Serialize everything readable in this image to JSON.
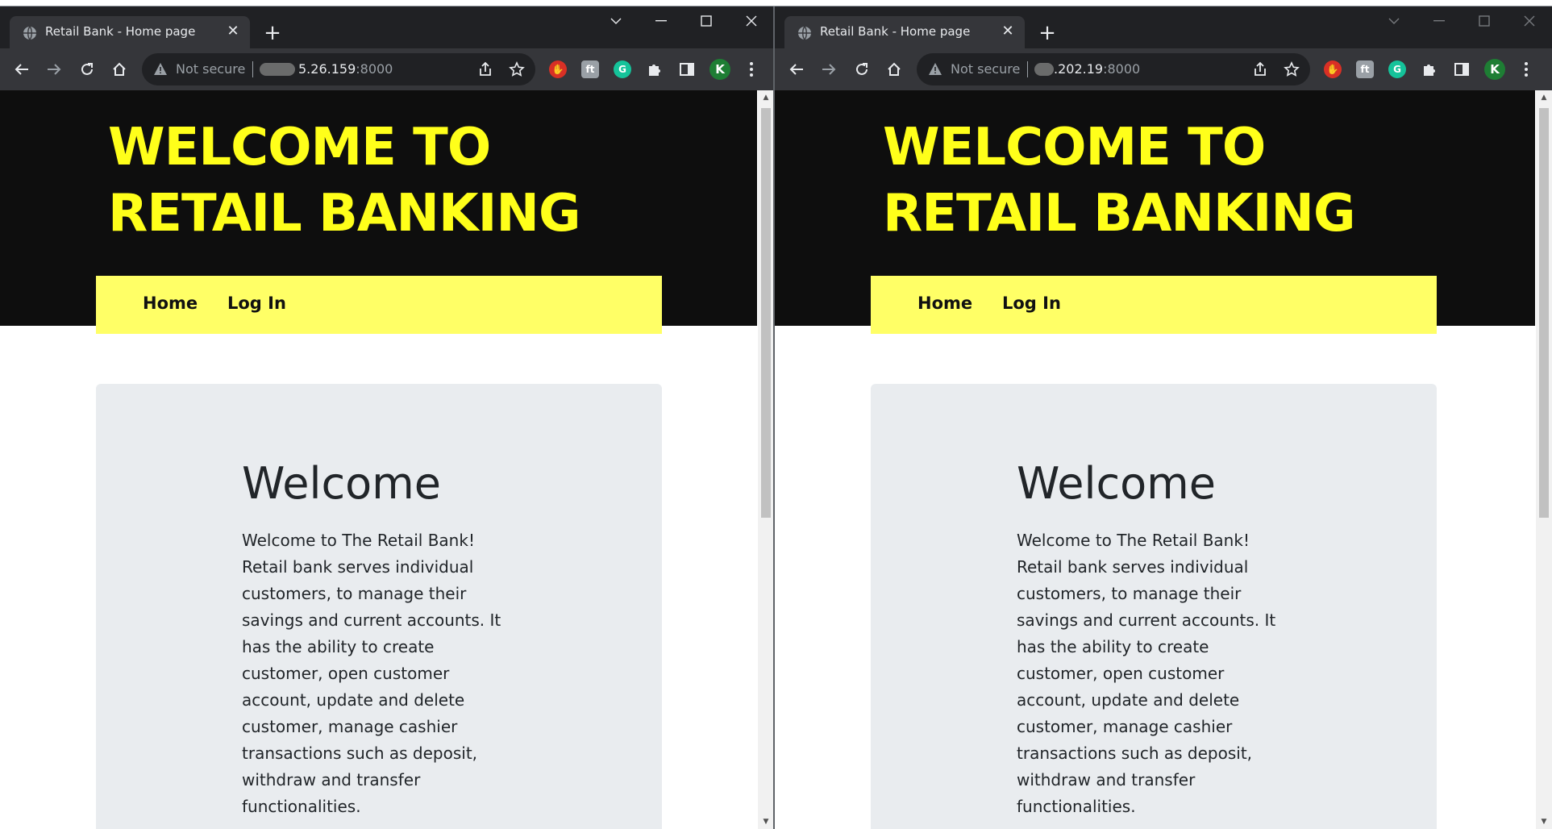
{
  "windows": [
    {
      "tab_title": "Retail Bank - Home page",
      "address": {
        "security": "Not secure",
        "host": "5.26.159",
        "port": ":8000"
      },
      "avatar_letter": "K",
      "page": {
        "title": "WELCOME TO RETAIL BANKING",
        "nav": [
          "Home",
          "Log In"
        ],
        "welcome_heading": "Welcome",
        "welcome_text": "Welcome to The Retail Bank! Retail bank serves individual customers, to manage their savings and current accounts. It has the ability to create customer, open customer account, update and delete customer, manage cashier transactions such as deposit, withdraw and transfer functionalities."
      }
    },
    {
      "tab_title": "Retail Bank - Home page",
      "address": {
        "security": "Not secure",
        "host": ".202.19",
        "port": ":8000"
      },
      "avatar_letter": "K",
      "page": {
        "title": "WELCOME TO RETAIL BANKING",
        "nav": [
          "Home",
          "Log In"
        ],
        "welcome_heading": "Welcome",
        "welcome_text": "Welcome to The Retail Bank! Retail bank serves individual customers, to manage their savings and current accounts. It has the ability to create customer, open customer account, update and delete customer, manage cashier transactions such as deposit, withdraw and transfer functionalities."
      }
    }
  ],
  "colors": {
    "header_bg": "#0e0e0e",
    "title_yellow": "#ffff1a",
    "nav_yellow": "#ffff66",
    "card_bg": "#e9ecef",
    "chrome_dark": "#202124",
    "chrome_toolbar": "#35363a"
  },
  "icons": {
    "favicon": "globe-icon",
    "close": "close-icon",
    "new_tab": "plus-icon",
    "back": "arrow-left-icon",
    "forward": "arrow-right-icon",
    "reload": "reload-icon",
    "home": "home-icon",
    "warning": "warning-icon",
    "share": "share-icon",
    "bookmark": "star-icon",
    "extensions": "puzzle-icon",
    "side_panel": "side-panel-icon",
    "menu": "kebab-menu-icon"
  }
}
